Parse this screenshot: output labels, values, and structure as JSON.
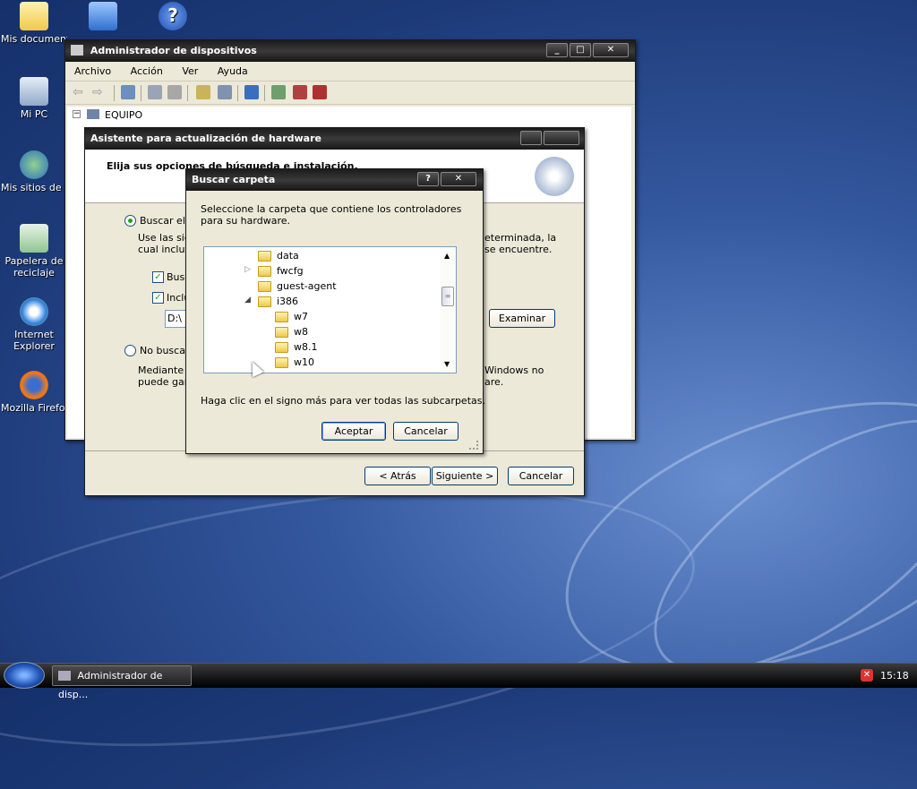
{
  "desktop": {
    "icons": [
      {
        "label": "Mis documentos"
      },
      {
        "label": "Mi PC"
      },
      {
        "label": "Mis sitios de red"
      },
      {
        "label": "Papelera de reciclaje"
      },
      {
        "label": "Internet Explorer"
      },
      {
        "label": "Mozilla Firefox"
      }
    ]
  },
  "device_manager": {
    "title": "Administrador de dispositivos",
    "menu": [
      "Archivo",
      "Acción",
      "Ver",
      "Ayuda"
    ],
    "tree_root": "EQUIPO"
  },
  "wizard": {
    "title": "Asistente para actualización de hardware",
    "heading": "Elija sus opciones de búsqueda e instalación.",
    "radio_search": "Buscar el c",
    "search_desc_1": "Use las sig",
    "search_desc_1b": "eterminada, la",
    "search_desc_2": "cual incluye",
    "search_desc_2b": "se encuentre.",
    "check_1": "Busc",
    "check_2": "Inclu",
    "path_value": "D:\\",
    "browse_label": "Examinar",
    "radio_nosearch": "No buscar",
    "nosearch_desc_1": "Mediante e",
    "nosearch_desc_1b": "Windows no",
    "nosearch_desc_2": "puede gara",
    "nosearch_desc_2b": "are.",
    "back_label": "< Atrás",
    "next_label": "Siguiente >",
    "cancel_label": "Cancelar"
  },
  "browse_dialog": {
    "title": "Buscar carpeta",
    "help_symbol": "?",
    "close_symbol": "✕",
    "instructions": "Seleccione la carpeta que contiene los controladores para su hardware.",
    "folders": [
      {
        "name": "data",
        "expander": ""
      },
      {
        "name": "fwcfg",
        "expander": "▷"
      },
      {
        "name": "guest-agent",
        "expander": ""
      },
      {
        "name": "i386",
        "expander": "◢"
      },
      {
        "name": "w7",
        "expander": ""
      },
      {
        "name": "w8",
        "expander": ""
      },
      {
        "name": "w8.1",
        "expander": ""
      },
      {
        "name": "w10",
        "expander": ""
      }
    ],
    "hint": "Haga clic en el signo más para ver todas las subcarpetas.",
    "ok_label": "Aceptar",
    "cancel_label": "Cancelar"
  },
  "taskbar": {
    "task_label": "Administrador de disp...",
    "clock": "15:18"
  }
}
